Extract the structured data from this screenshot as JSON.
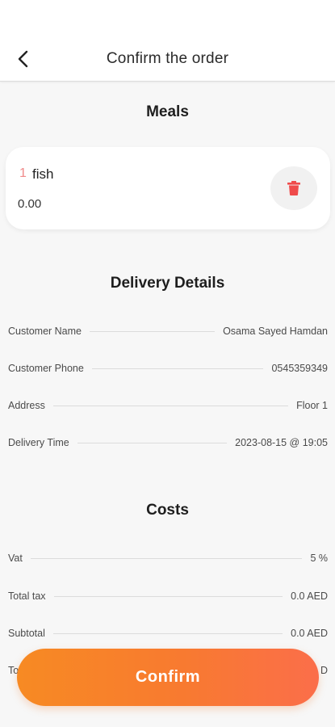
{
  "header": {
    "title": "Confirm the order",
    "back_icon": "chevron-left-icon"
  },
  "meals": {
    "title": "Meals",
    "items": [
      {
        "qty": "1",
        "name": "fish",
        "price": "0.00",
        "delete_icon": "trash-icon"
      }
    ]
  },
  "delivery": {
    "title": "Delivery Details",
    "rows": [
      {
        "label": "Customer Name",
        "value": "Osama Sayed Hamdan"
      },
      {
        "label": "Customer Phone",
        "value": "0545359349"
      },
      {
        "label": "Address",
        "value": "Floor 1"
      },
      {
        "label": "Delivery Time",
        "value": "2023-08-15 @ 19:05"
      }
    ]
  },
  "costs": {
    "title": "Costs",
    "rows": [
      {
        "label": "Vat",
        "value": "5 %"
      },
      {
        "label": "Total tax",
        "value": "0.0 AED"
      },
      {
        "label": "Subtotal",
        "value": "0.0 AED"
      },
      {
        "label": "To",
        "value": "D"
      }
    ]
  },
  "confirm_button": {
    "label": "Confirm"
  },
  "colors": {
    "accent": "#f78a23",
    "qty": "#f08a8a",
    "delete_icon": "#ef4b4b"
  }
}
